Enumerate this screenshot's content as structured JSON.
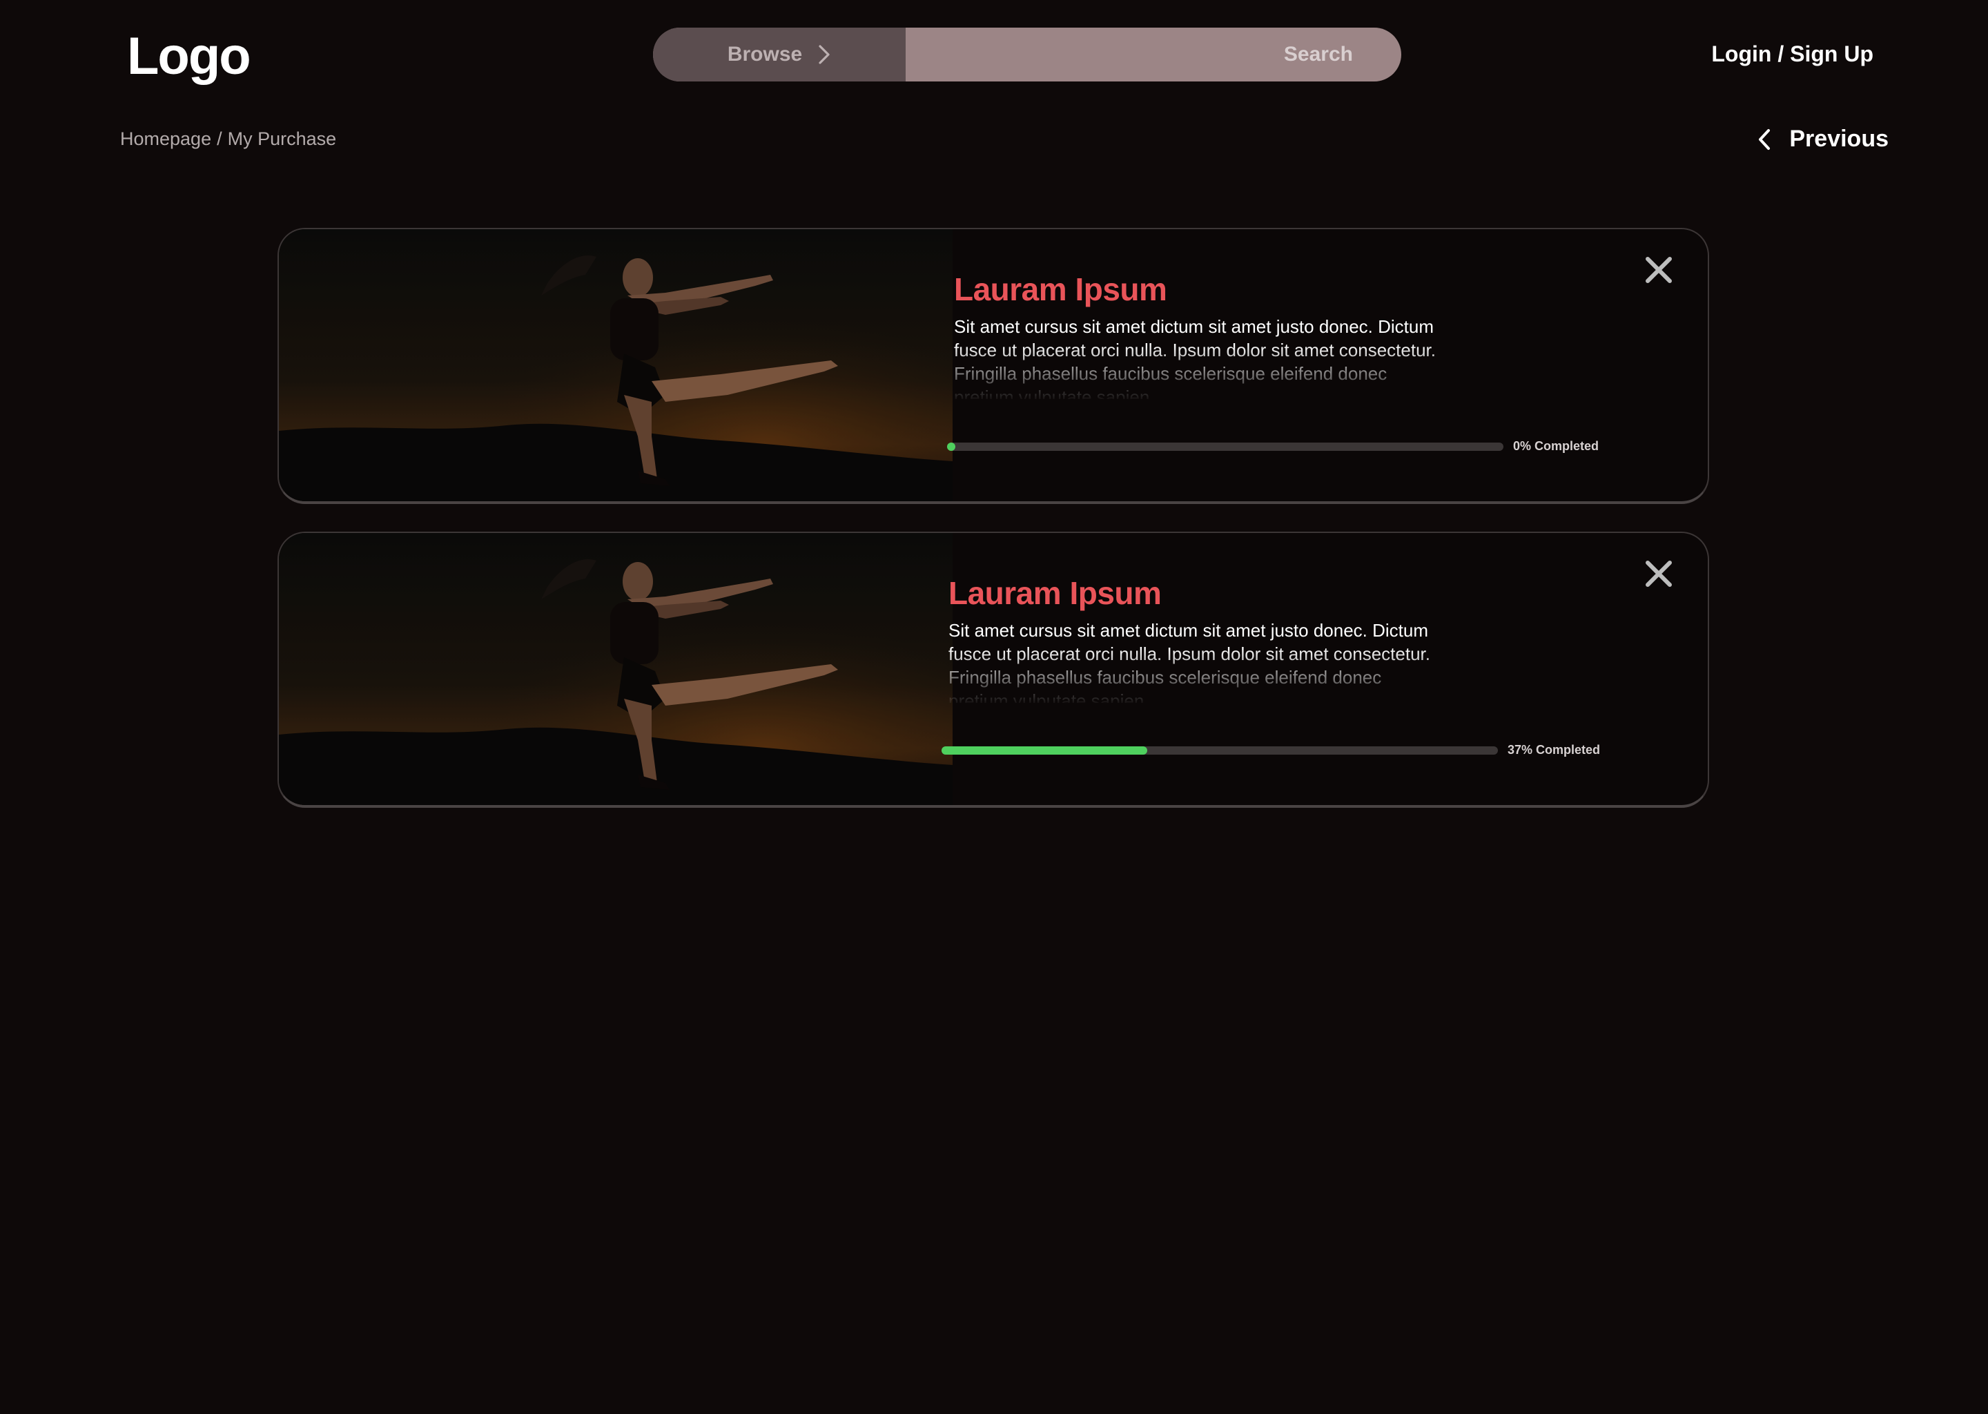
{
  "header": {
    "logo": "Logo",
    "browse_label": "Browse",
    "search_placeholder": "Search",
    "login_label": "Login / Sign Up"
  },
  "breadcrumb": {
    "home": "Homepage",
    "separator": "/",
    "current": "My Purchase"
  },
  "previous_label": "Previous",
  "courses": [
    {
      "title": "Lauram Ipsum",
      "description": "Sit amet cursus sit amet dictum sit amet justo donec. Dictum fusce ut placerat orci nulla. Ipsum dolor sit amet consectetur. Fringilla phasellus faucibus scelerisque eleifend donec pretium vulputate sapien.",
      "progress_percent": 0,
      "progress_label": "0% Completed",
      "image_icon": "dancer-photo",
      "close_icon": "close-icon"
    },
    {
      "title": "Lauram Ipsum",
      "description": "Sit amet cursus sit amet dictum sit amet justo donec. Dictum fusce ut placerat orci nulla. Ipsum dolor sit amet consectetur. Fringilla phasellus faucibus scelerisque eleifend donec pretium vulputate sapien.",
      "progress_percent": 37,
      "progress_label": "37% Completed",
      "image_icon": "dancer-photo",
      "close_icon": "close-icon"
    }
  ],
  "icons": {
    "browse": "chevron-right-icon",
    "previous": "chevron-left-icon"
  },
  "colors": {
    "background": "#0e0909",
    "title_accent": "#e95459",
    "progress_fill": "#4fd05e",
    "progress_track": "#3b3636",
    "browse_bg": "#5b4d4f",
    "search_bg": "#9c8586"
  }
}
